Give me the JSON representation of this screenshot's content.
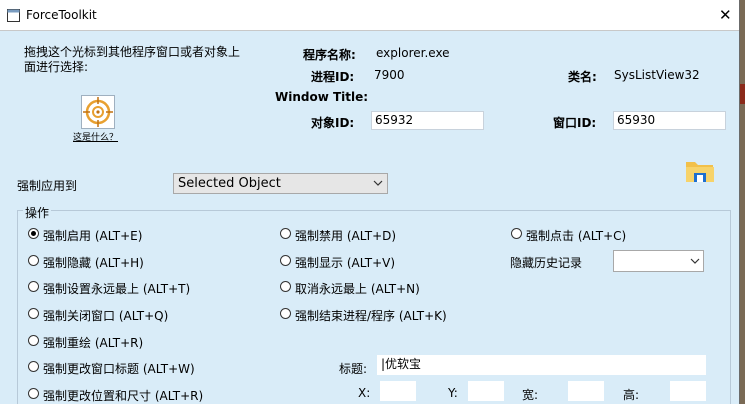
{
  "window": {
    "title": "ForceToolkit",
    "close_glyph": "✕"
  },
  "finder": {
    "instruction": "拖拽这个光标到其他程序窗口或者对象上面进行选择:",
    "help_link": "这是什么？"
  },
  "info": {
    "program_label": "程序名称:",
    "program_value": "explorer.exe",
    "pid_label": "进程ID:",
    "pid_value": "7900",
    "class_label": "类名:",
    "class_value": "SysListView32",
    "window_title_label": "Window Title:",
    "object_id_label": "对象ID:",
    "object_id_value": "65932",
    "window_id_label": "窗口ID:",
    "window_id_value": "65930"
  },
  "apply": {
    "label": "强制应用到",
    "selected": "Selected Object"
  },
  "ops": {
    "group_label": "操作",
    "enable": "强制启用 (ALT+E)",
    "disable": "强制禁用 (ALT+D)",
    "click": "强制点击 (ALT+C)",
    "hide": "强制隐藏 (ALT+H)",
    "show": "强制显示 (ALT+V)",
    "hide_history_label": "隐藏历史记录",
    "topmost": "强制设置永远最上 (ALT+T)",
    "untop": "取消永远最上 (ALT+N)",
    "close": "强制关闭窗口 (ALT+Q)",
    "kill": "强制结束进程/程序 (ALT+K)",
    "redraw": "强制重绘 (ALT+R)",
    "retitle": "强制更改窗口标题 (ALT+W)",
    "title_label": "标题:",
    "title_value": "|优软宝",
    "resize": "强制更改位置和尺寸 (ALT+R)",
    "x_label": "X:",
    "y_label": "Y:",
    "w_label": "宽:",
    "h_label": "高:"
  },
  "colors": {
    "dialog_bg": "#d9ecf8",
    "accent_orange": "#e8a030",
    "folder_blue": "#1e6fd0"
  }
}
